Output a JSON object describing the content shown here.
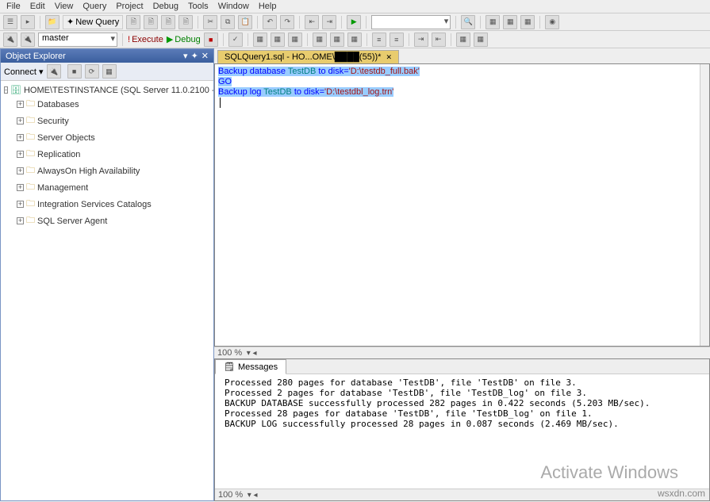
{
  "menu": {
    "items": [
      "File",
      "Edit",
      "View",
      "Query",
      "Project",
      "Debug",
      "Tools",
      "Window",
      "Help"
    ]
  },
  "toolbar1": {
    "new_query": "New Query"
  },
  "toolbar2": {
    "db_selector": "master",
    "execute": "Execute",
    "debug": "Debug"
  },
  "object_explorer": {
    "title": "Object Explorer",
    "connect_label": "Connect ▾",
    "server": "HOME\\TESTINSTANCE (SQL Server 11.0.2100 - ",
    "nodes": [
      "Databases",
      "Security",
      "Server Objects",
      "Replication",
      "AlwaysOn High Availability",
      "Management",
      "Integration Services Catalogs",
      "SQL Server Agent"
    ]
  },
  "editor": {
    "tab_label": "SQLQuery1.sql - HO...OME\\████(55))*",
    "line1": {
      "pre": "Backup database ",
      "id": "TestDB",
      "mid": " to disk=",
      "str": "'D:\\testdb_full.bak'"
    },
    "line2": "GO",
    "line3": {
      "pre": "Backup ",
      "kw": "log",
      "sp": " ",
      "id": "TestDB",
      "mid": " to disk=",
      "str": "'D:\\testdbl_log.trn'"
    },
    "zoom": "100 %"
  },
  "messages": {
    "tab": "Messages",
    "body": "Processed 280 pages for database 'TestDB', file 'TestDB' on file 3.\nProcessed 2 pages for database 'TestDB', file 'TestDB_log' on file 3.\nBACKUP DATABASE successfully processed 282 pages in 0.422 seconds (5.203 MB/sec).\nProcessed 28 pages for database 'TestDB', file 'TestDB_log' on file 1.\nBACKUP LOG successfully processed 28 pages in 0.087 seconds (2.469 MB/sec).",
    "zoom": "100 %"
  },
  "watermark": "Activate Windows",
  "wsxdn": "wsxdn.com"
}
